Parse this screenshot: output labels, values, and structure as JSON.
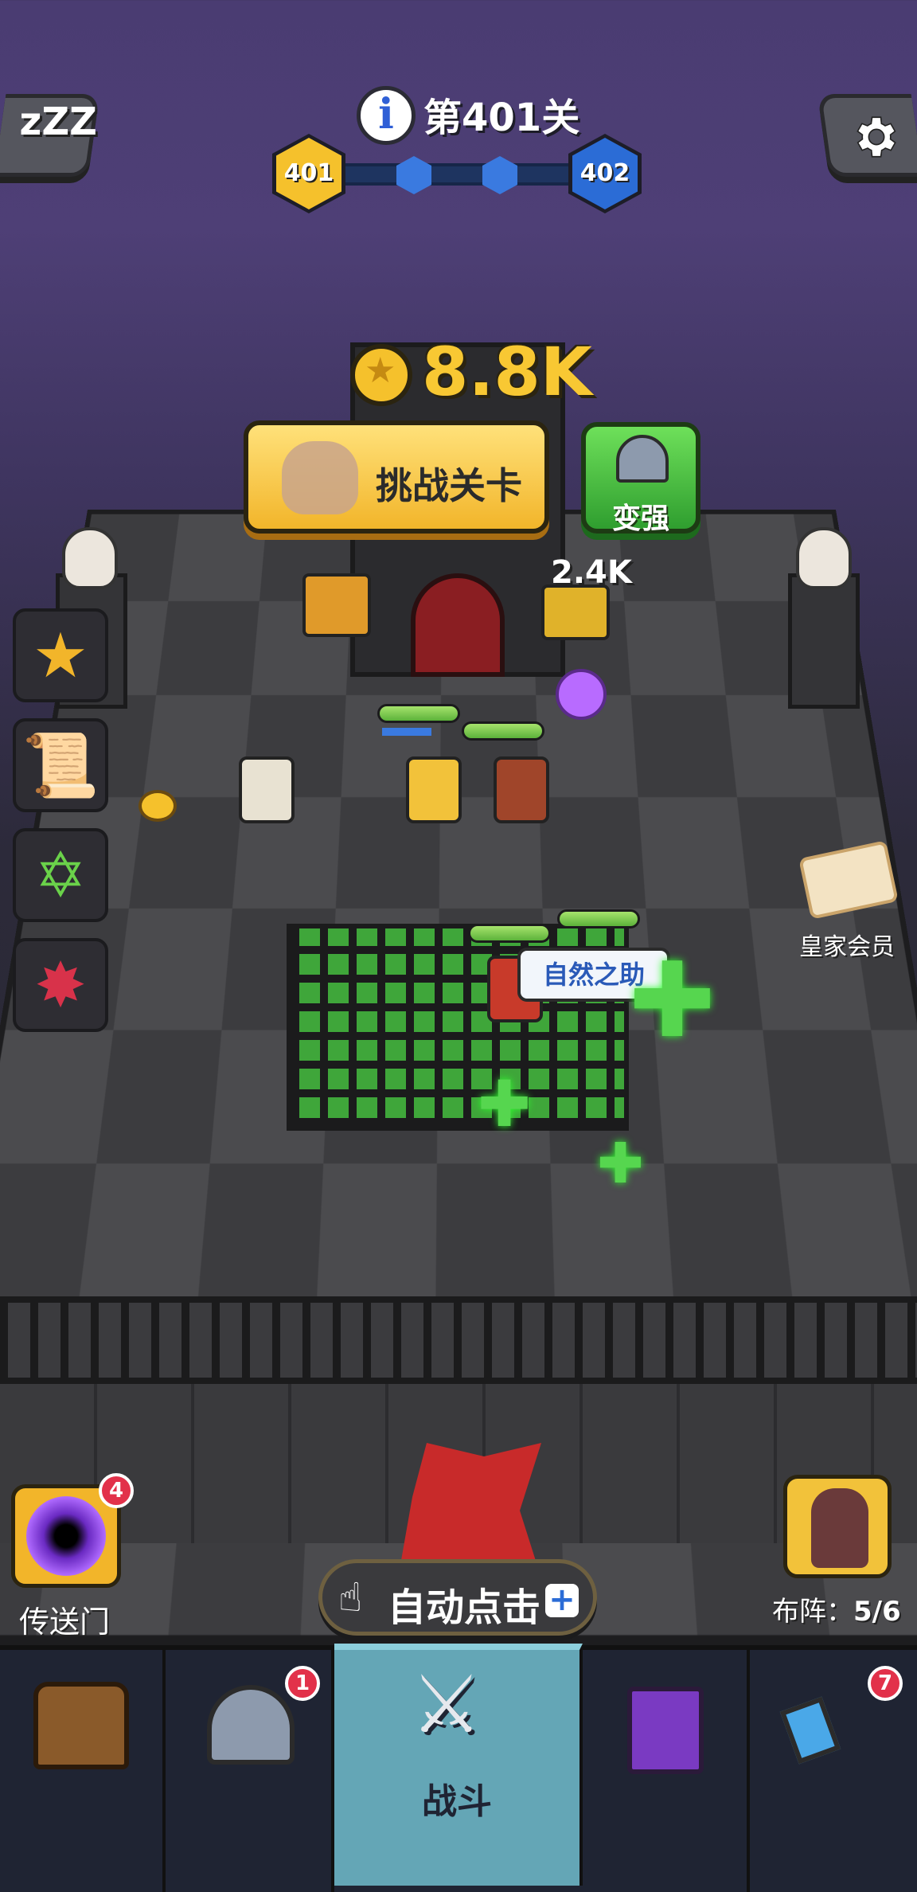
{
  "header": {
    "sleep_label": "zZZ",
    "level_title": "第401关",
    "current_level": "401",
    "next_level": "402"
  },
  "gold": {
    "amount": "8.8K"
  },
  "buttons": {
    "challenge": "挑战关卡",
    "power_up": "变强",
    "auto_click": "自动点击"
  },
  "battle": {
    "damage_popup": "2.4K",
    "skill_tip": "自然之助"
  },
  "side": {
    "royal_member": "皇家会员"
  },
  "portal": {
    "label": "传送门",
    "badge": "4"
  },
  "formation": {
    "label": "布阵：",
    "count": "5/6"
  },
  "nav": {
    "tabs": [
      {
        "name": "chest",
        "label": ""
      },
      {
        "name": "heroes",
        "label": "",
        "badge": "1"
      },
      {
        "name": "battle",
        "label": "战斗"
      },
      {
        "name": "spellbook",
        "label": ""
      },
      {
        "name": "artifacts",
        "label": "",
        "badge": "7"
      }
    ]
  },
  "colors": {
    "gold": "#f8c833",
    "accent_blue": "#2b6cd6",
    "heal_green": "#56d64f",
    "active_tab": "#64a6b6"
  }
}
